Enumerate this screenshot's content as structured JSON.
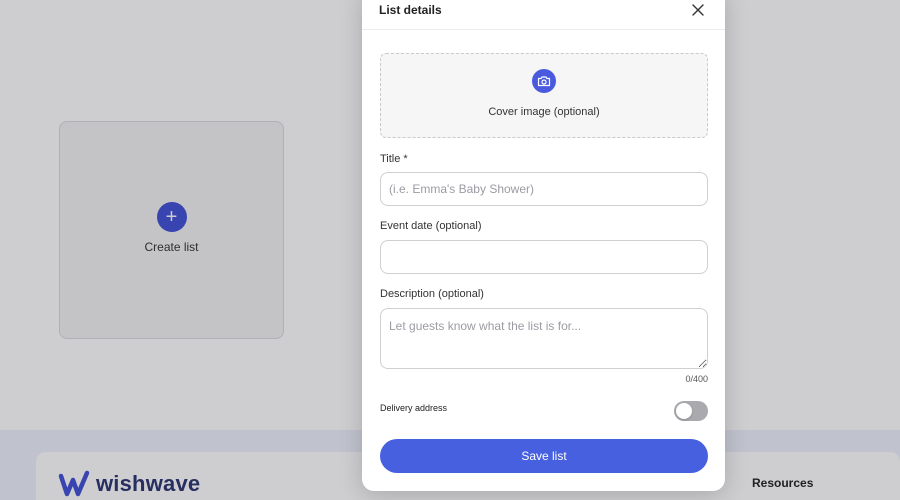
{
  "background": {
    "create_card": {
      "plus_glyph": "+",
      "label": "Create list"
    },
    "footer": {
      "brand_name": "wishwave",
      "resources_label": "Resources"
    }
  },
  "modal": {
    "title": "List details",
    "close_icon": "close-icon",
    "cover": {
      "label": "Cover image (optional)",
      "icon": "camera-icon"
    },
    "title_field": {
      "label": "Title *",
      "placeholder": "(i.e. Emma's Baby Shower)",
      "value": ""
    },
    "event_date": {
      "label": "Event date (optional)",
      "value": ""
    },
    "description": {
      "label": "Description (optional)",
      "placeholder": "Let guests know what the list is for...",
      "value": "",
      "counter": "0/400"
    },
    "delivery": {
      "label": "Delivery address",
      "enabled": false
    },
    "save_label": "Save list"
  },
  "colors": {
    "accent": "#4660e0",
    "brand": "#2a3270",
    "toggle_off": "#a9a9ae"
  }
}
